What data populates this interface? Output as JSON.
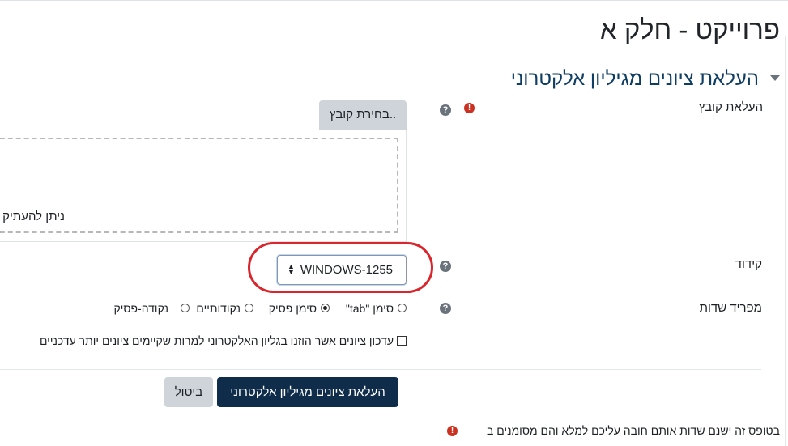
{
  "page": {
    "title": "פרוייקט - חלק א"
  },
  "section": {
    "title": "העלאת ציונים מגיליון אלקטרוני"
  },
  "file_upload": {
    "label": "העלאת קובץ",
    "choose_button": "בחירת קובץ..",
    "dropzone_text": "ניתן להעתיק"
  },
  "encoding": {
    "label": "קידוד",
    "value": "WINDOWS-1255"
  },
  "separator": {
    "label": "מפריד שדות",
    "options": [
      {
        "label": "סימן \"tab\"",
        "checked": false
      },
      {
        "label": "סימן פסיק",
        "checked": true
      },
      {
        "label": "נקודותיים",
        "checked": false
      },
      {
        "label": "נקודה-פסיק",
        "checked": false
      }
    ]
  },
  "update_checkbox": {
    "label": "עדכון ציונים אשר הוזנו בגליון האלקטרוני למרות שקיימים ציונים יותר עדכניים",
    "checked": false
  },
  "buttons": {
    "submit": "העלאת ציונים מגיליון אלקטרוני",
    "cancel": "ביטול"
  },
  "required_note": "בטופס זה ישנם שדות אותם חובה עליכם למלא והם מסומנים ב",
  "icons": {
    "help": "question-circle-icon",
    "required": "exclamation-circle-icon",
    "collapse": "caret-down-icon"
  },
  "colors": {
    "primary": "#0f2d4b",
    "heading": "#0f3d63",
    "annotation": "#d9262c",
    "required": "#ca3120"
  }
}
